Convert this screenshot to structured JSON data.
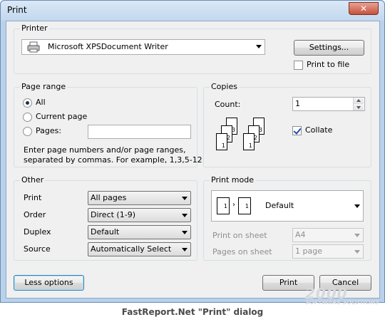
{
  "window": {
    "title": "Print",
    "close_glyph": "✕"
  },
  "printer": {
    "group_label": "Printer",
    "selected": "Microsoft XPSDocument Writer",
    "icon": "printer-icon",
    "settings_label": "Settings...",
    "print_to_file_label": "Print to file",
    "print_to_file_checked": false
  },
  "page_range": {
    "group_label": "Page range",
    "options": [
      {
        "label": "All",
        "checked": true
      },
      {
        "label": "Current page",
        "checked": false
      },
      {
        "label": "Pages:",
        "checked": false
      }
    ],
    "pages_value": "",
    "help_line1": "Enter page numbers and/or page ranges,",
    "help_line2": "separated by commas. For example, 1,3,5-12"
  },
  "copies": {
    "group_label": "Copies",
    "count_label": "Count:",
    "count_value": "1",
    "collate_label": "Collate",
    "collate_checked": true,
    "collate_pages": [
      "3",
      "2",
      "1",
      "3",
      "2",
      "1"
    ]
  },
  "other": {
    "group_label": "Other",
    "rows": [
      {
        "label": "Print",
        "value": "All pages"
      },
      {
        "label": "Order",
        "value": "Direct (1-9)"
      },
      {
        "label": "Duplex",
        "value": "Default"
      },
      {
        "label": "Source",
        "value": "Automatically Select"
      }
    ]
  },
  "print_mode": {
    "group_label": "Print mode",
    "mode_value": "Default",
    "mode_pages": [
      "1",
      "1"
    ],
    "print_on_sheet_label": "Print on sheet",
    "print_on_sheet_value": "A4",
    "pages_on_sheet_label": "Pages on sheet",
    "pages_on_sheet_value": "1 page"
  },
  "buttons": {
    "less_options": "Less options",
    "print": "Print",
    "cancel": "Cancel"
  },
  "caption": "FastReport.Net \"Print\" dialog",
  "watermark": {
    "line1": "2000",
    "line2": "SOFTWARE SOLUTIONS"
  }
}
